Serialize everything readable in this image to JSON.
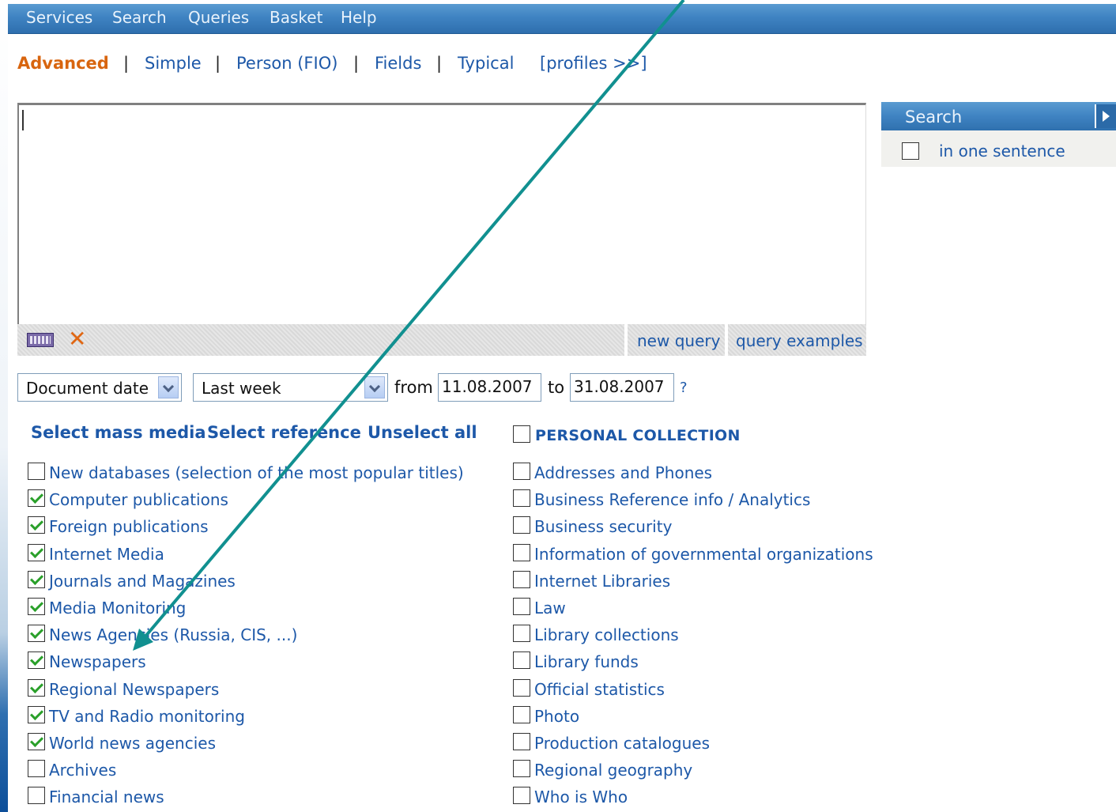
{
  "menu": {
    "items": [
      "Services",
      "Search",
      "Queries",
      "Basket",
      "Help"
    ]
  },
  "tabs": {
    "advanced": "Advanced",
    "simple": "Simple",
    "person": "Person (FIO)",
    "fields": "Fields",
    "typical": "Typical",
    "profiles": "[profiles >>]",
    "separator": "|"
  },
  "query": {
    "value": "",
    "new_query": "new query",
    "query_examples": "query examples",
    "keyboard_icon": "keyboard-icon",
    "clear_icon": "close-icon"
  },
  "search_panel": {
    "title": "Search",
    "in_one_sentence": "in one sentence",
    "in_one_sentence_checked": false
  },
  "date_filter": {
    "date_type": "Document date",
    "period": "Last week",
    "from_label": "from",
    "from_value": "11.08.2007",
    "to_label": "to",
    "to_value": "31.08.2007",
    "help": "?"
  },
  "selection": {
    "select_mass_media": "Select mass media",
    "select_reference": "Select reference",
    "unselect_all": "Unselect all",
    "personal_collection": "PERSONAL COLLECTION",
    "personal_collection_checked": false
  },
  "left_sources": [
    {
      "label": "New databases (selection of the most popular titles)",
      "checked": false
    },
    {
      "label": "Computer publications",
      "checked": true
    },
    {
      "label": "Foreign publications",
      "checked": true
    },
    {
      "label": "Internet Media",
      "checked": true
    },
    {
      "label": "Journals and Magazines",
      "checked": true
    },
    {
      "label": "Media Monitoring",
      "checked": true
    },
    {
      "label": "News Agencies (Russia, CIS, ...)",
      "checked": true
    },
    {
      "label": "Newspapers",
      "checked": true
    },
    {
      "label": "Regional Newspapers",
      "checked": true
    },
    {
      "label": "TV and Radio monitoring",
      "checked": true
    },
    {
      "label": "World news agencies",
      "checked": true
    },
    {
      "label": "Archives",
      "checked": false
    },
    {
      "label": "Financial news",
      "checked": false
    }
  ],
  "right_sources": [
    {
      "label": "Addresses and Phones",
      "checked": false
    },
    {
      "label": "Business Reference info / Analytics",
      "checked": false
    },
    {
      "label": "Business security",
      "checked": false
    },
    {
      "label": "Information of governmental organizations",
      "checked": false
    },
    {
      "label": "Internet Libraries",
      "checked": false
    },
    {
      "label": "Law",
      "checked": false
    },
    {
      "label": "Library collections",
      "checked": false
    },
    {
      "label": "Library funds",
      "checked": false
    },
    {
      "label": "Official statistics",
      "checked": false
    },
    {
      "label": "Photo",
      "checked": false
    },
    {
      "label": "Production catalogues",
      "checked": false
    },
    {
      "label": "Regional geography",
      "checked": false
    },
    {
      "label": "Who is Who",
      "checked": false
    }
  ],
  "colors": {
    "accent": "#1d58a8",
    "active_tab": "#d8650f",
    "menubar": "#3f83c2",
    "arrow": "#119090",
    "check": "#2aa02a"
  }
}
